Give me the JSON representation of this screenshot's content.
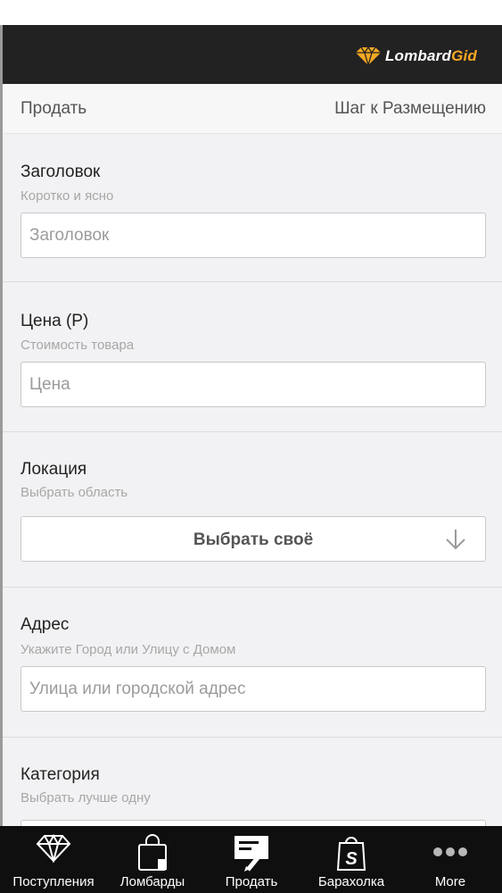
{
  "header": {
    "logo_main": "Lombard",
    "logo_accent": "Gid",
    "brand_color": "#f7a823"
  },
  "subheader": {
    "left_label": "Продать",
    "right_label": "Шаг к Размещению"
  },
  "sections": {
    "title": {
      "label": "Заголовок",
      "hint": "Коротко и ясно",
      "placeholder": "Заголовок",
      "value": ""
    },
    "price": {
      "label": "Цена (Р)",
      "hint": "Стоимость товара",
      "placeholder": "Цена",
      "value": ""
    },
    "location": {
      "label": "Локация",
      "hint": "Выбрать область",
      "button_label": "Выбрать своё"
    },
    "address": {
      "label": "Адрес",
      "hint": "Укажите Город или Улицу с Домом",
      "placeholder": "Улица или городской адрес",
      "value": ""
    },
    "category": {
      "label": "Категория",
      "hint": "Выбрать лучше одну"
    }
  },
  "tabbar": {
    "tabs": [
      {
        "label": "Поступления",
        "icon": "diamond-icon"
      },
      {
        "label": "Ломбарды",
        "icon": "shopping-bag-icon"
      },
      {
        "label": "Продать",
        "icon": "edit-document-icon"
      },
      {
        "label": "Барахолка",
        "icon": "shopify-bag-icon"
      },
      {
        "label": "More",
        "icon": "more-dots-icon"
      }
    ]
  }
}
